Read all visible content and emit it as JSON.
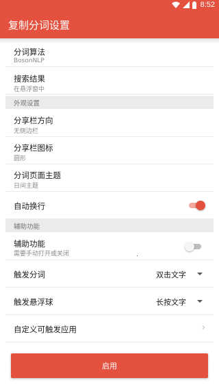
{
  "status_bar": {
    "time": "8:52",
    "icons": [
      "wifi-icon",
      "cell-signal-icon",
      "battery-icon"
    ]
  },
  "app_bar": {
    "title": "复制分词设置"
  },
  "colors": {
    "accent": "#e4513e",
    "toggle_track_on": "#f2a89e"
  },
  "settings": {
    "algorithm": {
      "title": "分词算法",
      "value": "BosonNLP"
    },
    "search_result": {
      "title": "搜索结果",
      "value": "在悬浮窗中"
    }
  },
  "appearance": {
    "header": "外观设置",
    "share_bar_direction": {
      "title": "分享栏方向",
      "value": "无侧边栏"
    },
    "share_bar_icon": {
      "title": "分享栏图标",
      "value": "圆形"
    },
    "page_theme": {
      "title": "分词页面主题",
      "value": "日间主题"
    },
    "auto_wrap": {
      "title": "自动换行",
      "checked": true
    }
  },
  "accessibility": {
    "header": "辅助功能",
    "assist": {
      "title": "辅助功能",
      "subtitle": "需要手动打开或关闭",
      "checked": false
    },
    "trigger_segment": {
      "title": "触发分词",
      "selected": "双击文字"
    },
    "trigger_float": {
      "title": "触发悬浮球",
      "selected": "长按文字"
    },
    "custom_apps": {
      "title": "自定义可触发应用"
    }
  },
  "footer": {
    "enable_label": "启用"
  }
}
